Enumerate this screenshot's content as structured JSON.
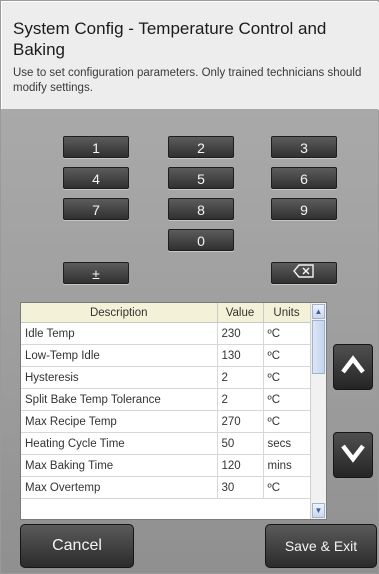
{
  "header": {
    "title": "System Config - Temperature Control and Baking",
    "subtitle": "Use to set configuration parameters. Only trained technicians should modify settings."
  },
  "keypad": {
    "keys": [
      "1",
      "2",
      "3",
      "4",
      "5",
      "6",
      "7",
      "8",
      "9",
      "0"
    ],
    "plus_minus": "±"
  },
  "table": {
    "headers": {
      "description": "Description",
      "value": "Value",
      "units": "Units"
    },
    "rows": [
      {
        "description": "Idle Temp",
        "value": "230",
        "units": "ºC"
      },
      {
        "description": "Low-Temp Idle",
        "value": "130",
        "units": "ºC"
      },
      {
        "description": "Hysteresis",
        "value": "2",
        "units": "ºC"
      },
      {
        "description": "Split Bake Temp Tolerance",
        "value": "2",
        "units": "ºC"
      },
      {
        "description": "Max Recipe Temp",
        "value": "270",
        "units": "ºC"
      },
      {
        "description": "Heating Cycle Time",
        "value": "50",
        "units": "secs"
      },
      {
        "description": "Max Baking Time",
        "value": "120",
        "units": "mins"
      },
      {
        "description": "Max Overtemp",
        "value": "30",
        "units": "ºC"
      }
    ]
  },
  "footer": {
    "cancel_label": "Cancel",
    "save_label": "Save & Exit"
  },
  "icons": {
    "backspace": "backspace-icon",
    "scroll_up": "chevron-up-icon",
    "scroll_down": "chevron-down-icon"
  },
  "colors": {
    "panel": "#9c9c9c",
    "key": "#3a3a3a",
    "table_header": "#f3f2d8"
  }
}
